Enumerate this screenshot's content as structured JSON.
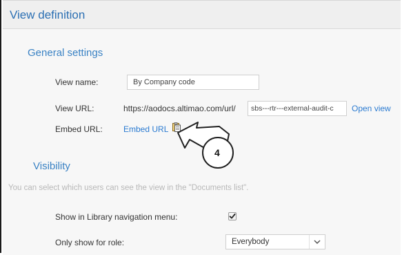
{
  "header": {
    "title": "View definition"
  },
  "general_settings": {
    "title": "General settings",
    "view_name_label": "View name:",
    "view_name_value": "By Company code",
    "view_url_label": "View URL:",
    "view_url_prefix": "https://aodocs.altimao.com/url/",
    "view_url_slug": "sbs---rtr---external-audit-c",
    "open_view_link": "Open view",
    "embed_url_label": "Embed URL:",
    "embed_url_link": "Embed URL",
    "copy_icon": "clipboard-icon"
  },
  "visibility": {
    "title": "Visibility",
    "hint": "You can select which users can see the view in the \"Documents list\".",
    "show_in_nav_label": "Show in Library navigation menu:",
    "show_in_nav_checked": true,
    "role_label": "Only show for role:",
    "role_selected": "Everybody"
  },
  "annotation": {
    "callout_number": "4"
  },
  "colors": {
    "accent": "#2b7bd1",
    "title": "#2b6fb3",
    "hint": "#b8b8b8"
  }
}
